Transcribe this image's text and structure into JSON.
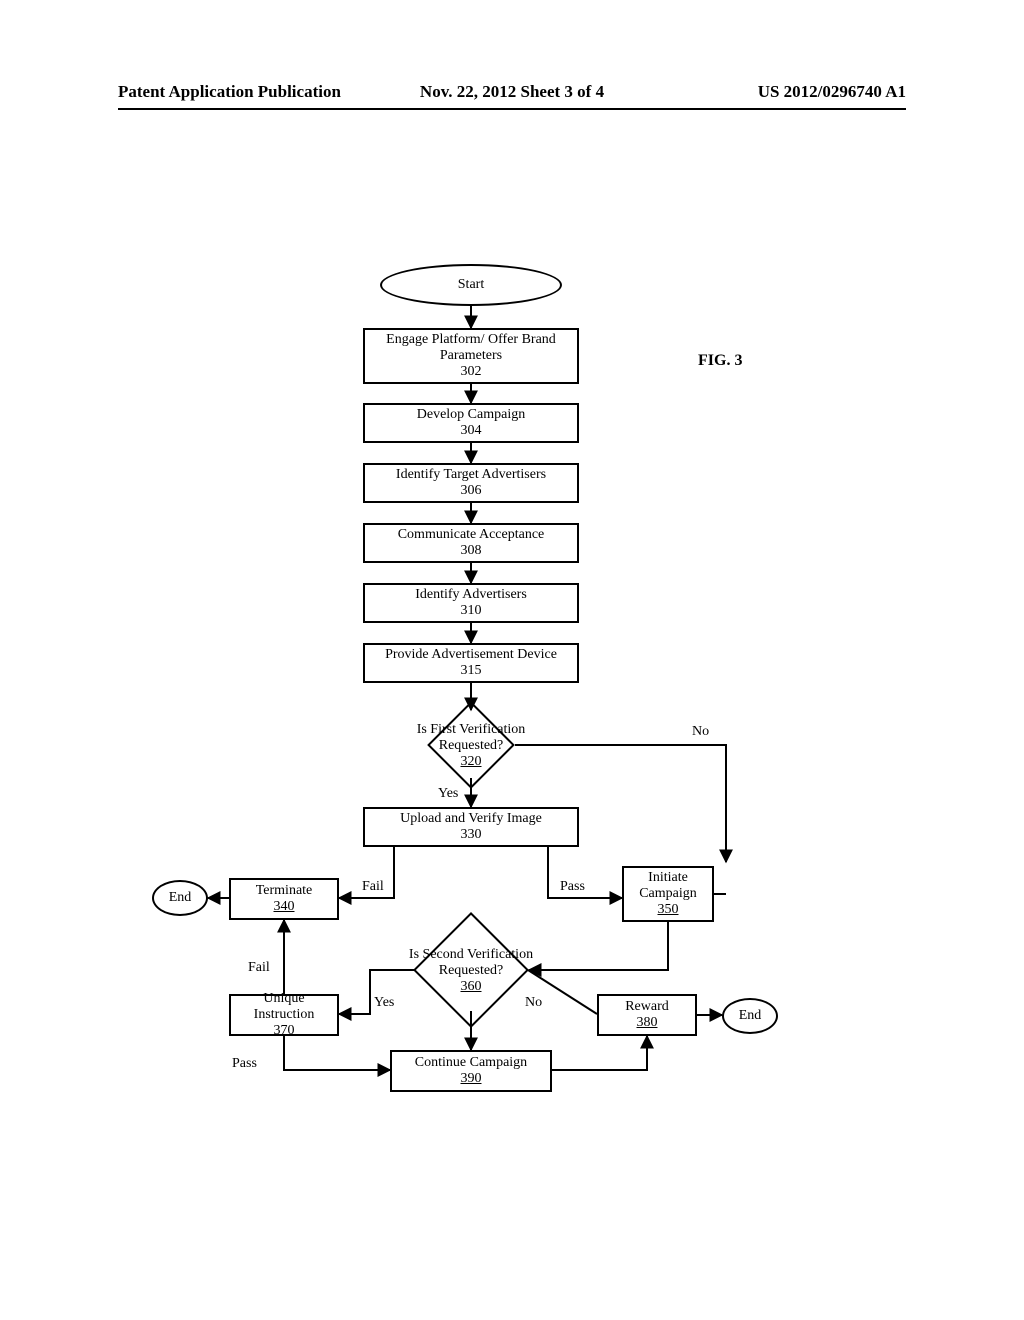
{
  "header": {
    "left": "Patent Application Publication",
    "mid": "Nov. 22, 2012  Sheet 3 of 4",
    "right": "US 2012/0296740 A1"
  },
  "figure_label": "FIG. 3",
  "nodes": {
    "start": "Start",
    "n302_t": "Engage Platform/ Offer Brand Parameters",
    "n302_n": "302",
    "n304_t": "Develop Campaign",
    "n304_n": "304",
    "n306_t": "Identify Target Advertisers",
    "n306_n": "306",
    "n308_t": "Communicate Acceptance",
    "n308_n": "308",
    "n310_t": "Identify Advertisers",
    "n310_n": "310",
    "n315_t": "Provide Advertisement Device",
    "n315_n": "315",
    "d320_t": "Is First Verification Requested?",
    "d320_n": "320",
    "n330_t": "Upload and Verify Image",
    "n330_n": "330",
    "n340_t": "Terminate",
    "n340_n": "340",
    "n350_t": "Initiate Campaign",
    "n350_n": "350",
    "d360_t": "Is Second Verification Requested?",
    "d360_n": "360",
    "n370_t": "Unique Instruction",
    "n370_n": "370",
    "n380_t": "Reward",
    "n380_n": "380",
    "n390_t": "Continue Campaign",
    "n390_n": "390",
    "end": "End"
  },
  "labels": {
    "no": "No",
    "yes": "Yes",
    "pass": "Pass",
    "fail": "Fail"
  }
}
